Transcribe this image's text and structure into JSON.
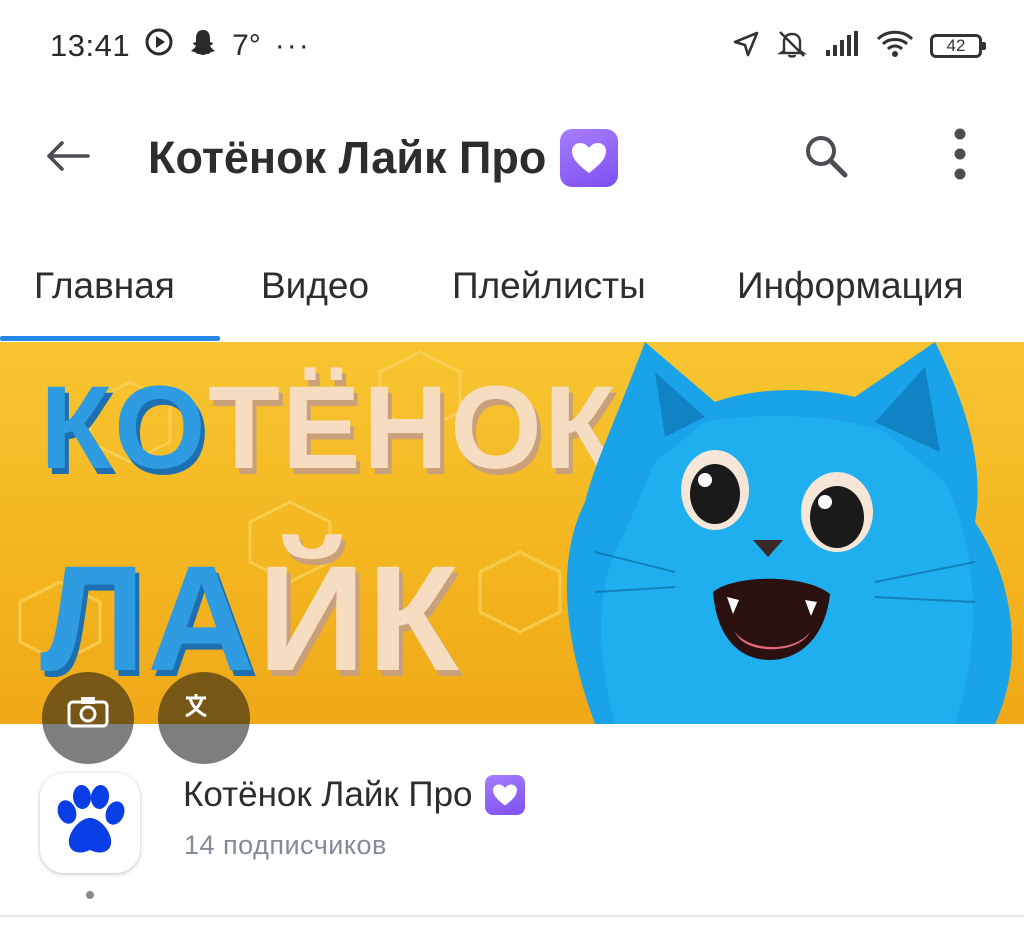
{
  "status_bar": {
    "time": "13:41",
    "temperature": "7°",
    "more": "···",
    "battery": "42",
    "icons": [
      "play-circle-icon",
      "snapchat-icon",
      "location-arrow-icon",
      "bell-off-icon",
      "signal-icon",
      "wifi-icon",
      "battery-icon"
    ]
  },
  "app_bar": {
    "title": "Котёнок Лайк Про",
    "icons": [
      "back-arrow-icon",
      "purple-heart-icon",
      "search-icon",
      "more-vertical-icon"
    ]
  },
  "tabs": [
    {
      "label": "Главная",
      "active": true
    },
    {
      "label": "Видео",
      "active": false
    },
    {
      "label": "Плейлисты",
      "active": false
    },
    {
      "label": "Информация",
      "active": false
    }
  ],
  "banner": {
    "line1": "КОТЁНОК",
    "line2": "ЛАЙК",
    "icons": [
      "camera-icon",
      "translate-icon"
    ]
  },
  "channel": {
    "name": "Котёнок Лайк Про",
    "subscribers": "14 подписчиков",
    "avatar_icon": "paw-icon"
  },
  "colors": {
    "accent": "#2688eb",
    "text_primary": "#2c2d2e",
    "text_secondary": "#818c99",
    "heart_badge": "#8b5cf6",
    "banner_bg": "#f5bd28",
    "cat_blue": "#1aa3e8"
  }
}
